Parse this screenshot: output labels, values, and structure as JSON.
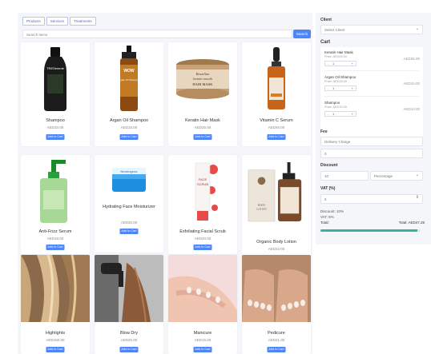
{
  "tabs": [
    "Products",
    "Services",
    "Treatments"
  ],
  "search": {
    "placeholder": "Search items",
    "button": "Search"
  },
  "products": [
    {
      "name": "Shampoo",
      "price": "AED10.00",
      "add": "Add to Cart"
    },
    {
      "name": "Argan Oil Shampoo",
      "price": "AED15.00",
      "add": "Add to Cart"
    },
    {
      "name": "Keratin Hair Mask",
      "price": "AED25.00",
      "add": "Add to Cart"
    },
    {
      "name": "Vitamin C Serum",
      "price": "AED40.00",
      "add": "Add to Cart"
    },
    {
      "name": "Anti-Frizz Serum",
      "price": "AED18.00",
      "add": "Add to Cart"
    },
    {
      "name": "Hydrating Face Moisturizer",
      "price": "AED30.00",
      "add": "Add to Cart"
    },
    {
      "name": "Exfoliating Facial Scrub",
      "price": "AED20.00",
      "add": "Add to Cart"
    },
    {
      "name": "Organic Body Lotion",
      "price": "AED22.00",
      "add": "Add to Cart"
    },
    {
      "name": "Highlights",
      "price": "AED150.00",
      "add": "Add to Cart"
    },
    {
      "name": "Blow Dry",
      "price": "AED20.00",
      "add": "Add to Cart"
    },
    {
      "name": "Manicure",
      "price": "AED15.00",
      "add": "Add to Cart"
    },
    {
      "name": "Pedicure",
      "price": "AED21.00",
      "add": "Add to Cart"
    }
  ],
  "product_labels": {
    "shampoo_brand": "TRESemmé",
    "argan_brand": "WOW",
    "argan_text": "Argan Oil Shampoo",
    "mask_text1": "Brazilian",
    "mask_text2": "keratin smooth",
    "mask_text3": "HAIR MASK",
    "moisturizer_brand": "Neutrogena",
    "scrub_text1": "FACE",
    "scrub_text2": "SCRUB",
    "lotion_text1": "BODY",
    "lotion_text2": "LOTION"
  },
  "right": {
    "client_label": "Client",
    "client_select": "Select Client",
    "cart_label": "Cart",
    "cart_items": [
      {
        "name": "Keratin Hair Mask",
        "price": "Price: AED25.00",
        "qty": "1",
        "total": "AED25.00"
      },
      {
        "name": "Argan Oil Shampoo",
        "price": "Price: AED15.00",
        "qty": "1",
        "total": "AED15.00"
      },
      {
        "name": "Shampoo",
        "price": "Price: AED10.00",
        "qty": "1",
        "total": "AED10.00"
      }
    ],
    "fee_label": "Fee",
    "fee_placeholder": "Delivery Charge",
    "fee_value": "0",
    "discount_label": "Discount",
    "discount_value": "10",
    "discount_type": "Percentage",
    "vat_label": "VAT (%)",
    "vat_value": "5",
    "discount_summary": "Discount: 10%",
    "vat_summary": "VAT: 5%",
    "total_label": "Total:",
    "total_value": "Total: AED47.25",
    "progress": 0.97
  },
  "colors": {
    "accent": "#4f86f7",
    "progress": "#3bb39c",
    "panel": "#f4f6fa"
  }
}
